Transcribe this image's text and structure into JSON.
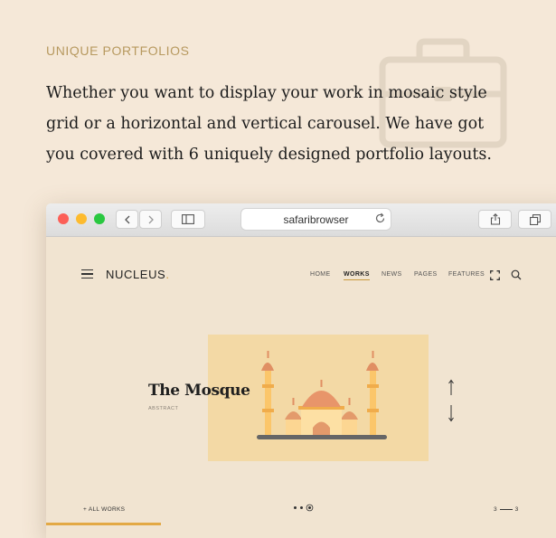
{
  "section": {
    "eyebrow": "UNIQUE PORTFOLIOS",
    "lead": "Whether you want to display your work in mosaic style grid or a horizontal and vertical carousel. We have got you covered with 6 uniquely designed portfolio layouts.",
    "background_icon": "briefcase-icon"
  },
  "browser": {
    "url": "safaribrowser",
    "toolbar_icons": [
      "back-icon",
      "forward-icon",
      "sidebar-icon",
      "reload-icon",
      "share-icon",
      "tabs-icon"
    ]
  },
  "site": {
    "logo": "NUCLEUS",
    "logo_dot": ".",
    "nav": [
      "HOME",
      "WORKS",
      "NEWS",
      "PAGES",
      "FEATURES"
    ],
    "active_nav": "WORKS",
    "project_title": "The Mosque",
    "project_category": "ABSTRACT",
    "all_works": "+ ALL WORKS",
    "counter_current": "3",
    "counter_total": "3",
    "accent_color": "#e3a945"
  }
}
